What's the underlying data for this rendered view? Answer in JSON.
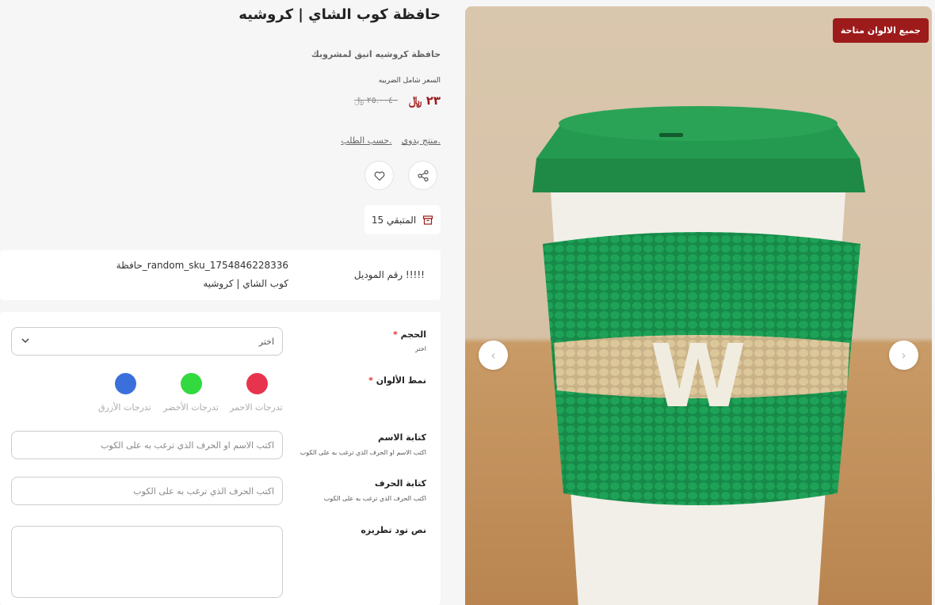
{
  "product": {
    "title": "حافظة كوب الشاي | كروشيه",
    "subtitle": "حافظة كروشيه انيق لمشروبك",
    "price_note": "السعر شامل الضريبه",
    "price": "٢٣ ﷼",
    "old_price": "٢٥.٠٠٤٠ ﷼",
    "tags": [
      "منتج يدوي.",
      "حسب الطلب."
    ],
    "stock_label": "المتبقي 15",
    "badge": "جميع الالوان متاحة"
  },
  "model": {
    "label": "!!!!! رقم الموديل",
    "sku": "حافظة_random_sku_1754846228336",
    "name": "كوب الشاي | كروشيه"
  },
  "form": {
    "size": {
      "label": "الحجم",
      "required": "*",
      "hint": "اختر",
      "value": "اختر"
    },
    "colors": {
      "label": "نمط الألوان",
      "required": "*",
      "options": [
        {
          "name": "تدرجات الاحمر",
          "color": "#e8334f"
        },
        {
          "name": "تدرجات الأخضر",
          "color": "#32d93f"
        },
        {
          "name": "تدرجات الأزرق",
          "color": "#3b6fdc"
        }
      ]
    },
    "name_text": {
      "label": "كتابة الاسم",
      "hint": "اكتب الاسم او الحرف الذي ترغب به على الكوب",
      "placeholder": "اكتب الاسم او الحرف الذي ترغب به على الكوب"
    },
    "letter_text": {
      "label": "كتابة الحرف",
      "hint": "اكتب الحرف الذي ترغب به على الكوب",
      "placeholder": "اكتب الحرف الذي ترغب به على الكوب"
    },
    "embroidery": {
      "label": "نص تود تطريزه"
    }
  },
  "gallery": {
    "cup_letter": "W",
    "icons": {
      "prev": "chevron-left-icon",
      "next": "chevron-right-icon",
      "share": "share-icon",
      "favorite": "heart-icon",
      "stock": "box-icon"
    },
    "colors": {
      "accent": "#9e1b1b",
      "sleeve": "#1a8a4a",
      "lid": "#1f8a45"
    }
  }
}
